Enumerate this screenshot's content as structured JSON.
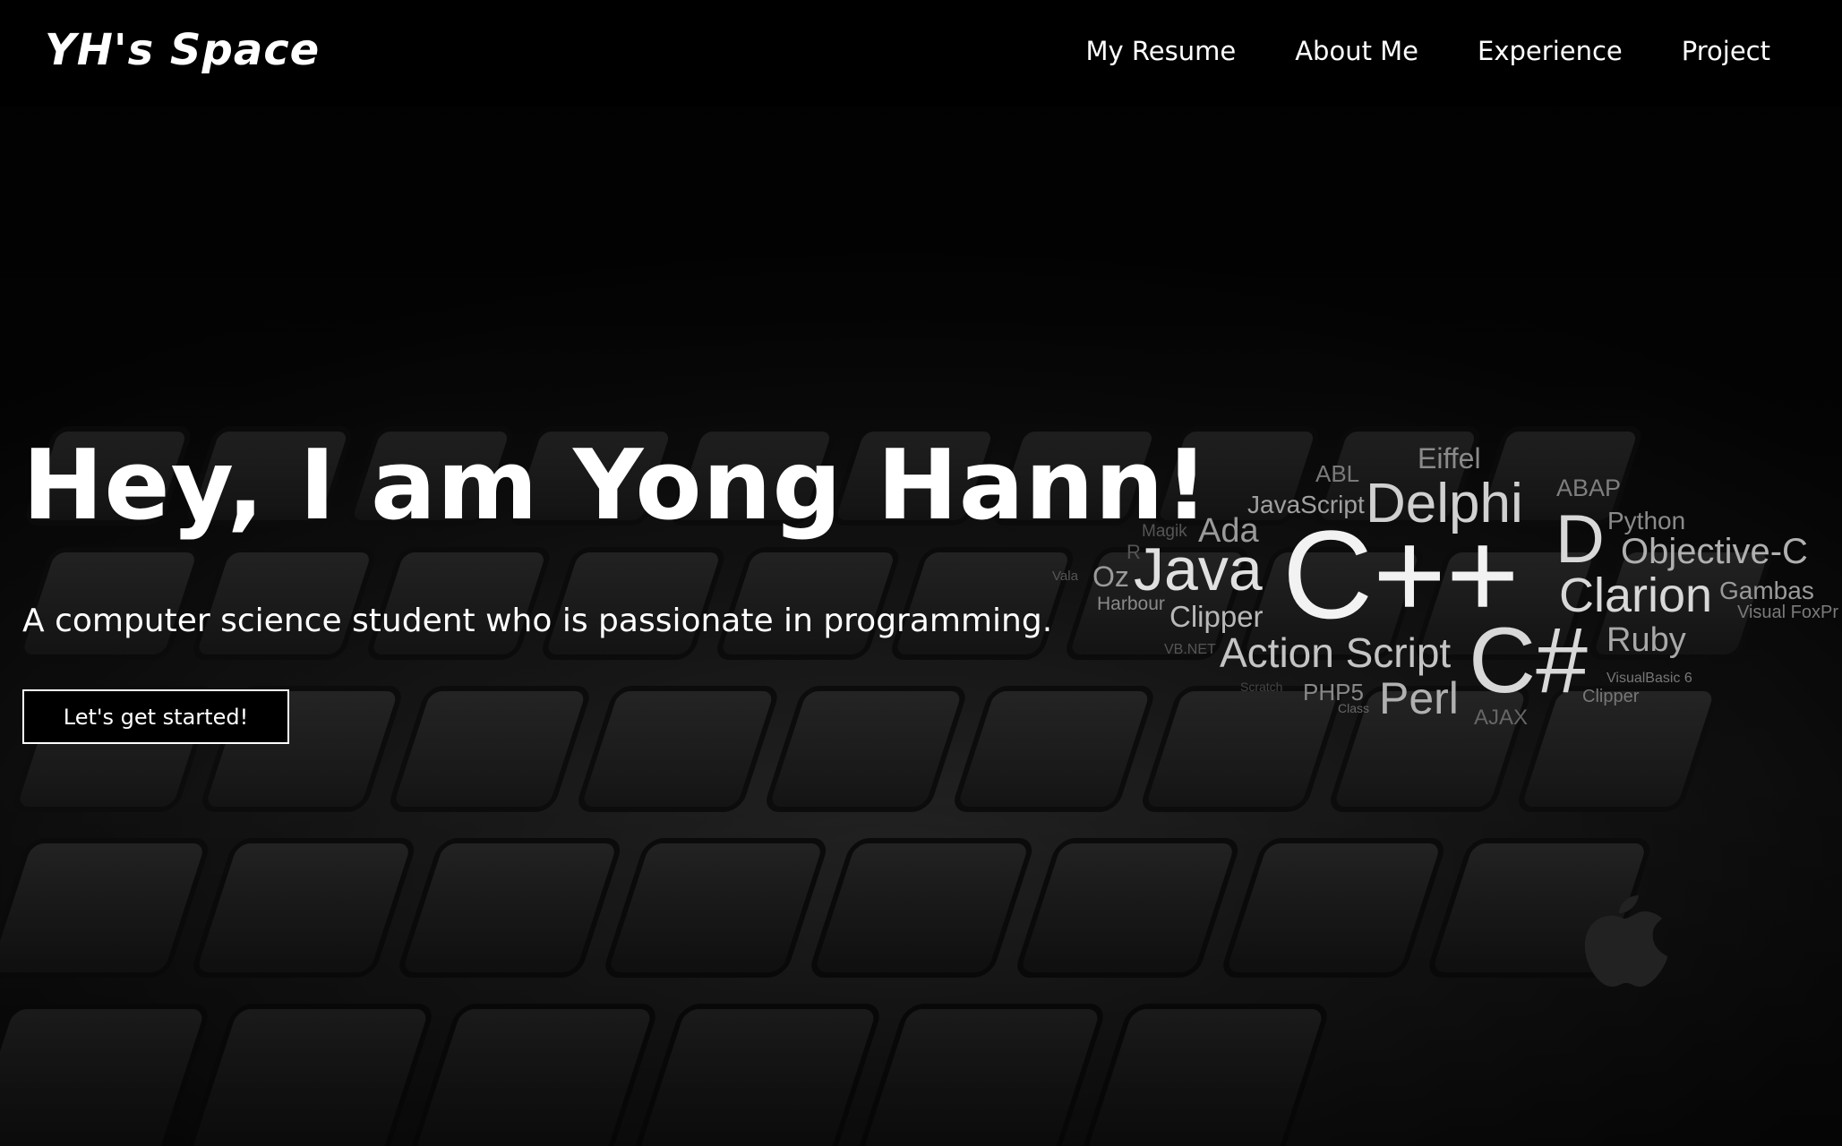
{
  "navbar": {
    "brand": "YH's Space",
    "links": [
      "My Resume",
      "About Me",
      "Experience",
      "Project"
    ]
  },
  "hero": {
    "title": "Hey, I am Yong Hann!",
    "subtitle": "A computer science student who is passionate in programming.",
    "cta_label": "Let's get started!"
  },
  "word_cloud": [
    "Eiffel",
    "ABL",
    "ABAP",
    "JavaScript",
    "Delphi",
    "Python",
    "Magik",
    "Ada",
    "D",
    "R",
    "Objective-C",
    "Vala",
    "Oz",
    "Java",
    "C++",
    "Clarion",
    "Gambas",
    "Visual FoxPr",
    "Harbour",
    "Clipper",
    "VB.NET",
    "Action Script",
    "C#",
    "Ruby",
    "Scratch",
    "PHP5",
    "Perl",
    "VisualBasic 6",
    "Class",
    "AJAX",
    "Clipper"
  ],
  "colors": {
    "navbar_bg": "#000000",
    "text": "#ffffff",
    "button_bg": "#000000",
    "button_border": "#ffffff"
  },
  "icons": {
    "background_logo": "apple-logo-icon"
  }
}
